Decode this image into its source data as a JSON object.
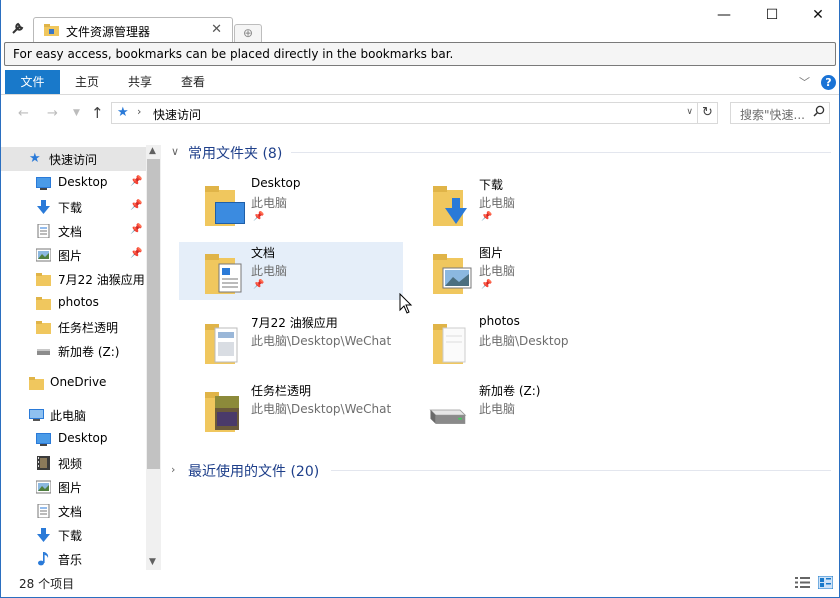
{
  "window": {
    "tab_title": "文件资源管理器",
    "controls": {
      "minimize": "—",
      "maximize": "☐",
      "close": "✕"
    }
  },
  "bookmark_notice": "For easy access, bookmarks can be placed directly in the bookmarks bar.",
  "ribbon": {
    "tabs": [
      "文件",
      "主页",
      "共享",
      "查看"
    ],
    "help": "?"
  },
  "address": {
    "location": "快速访问",
    "search_placeholder": "搜索\"快速...",
    "search_icon": "search-icon"
  },
  "sidebar": {
    "items": [
      {
        "label": "快速访问",
        "icon": "star-icon",
        "pinned": false,
        "selected": true
      },
      {
        "label": "Desktop",
        "icon": "desktop-icon",
        "pinned": true
      },
      {
        "label": "下载",
        "icon": "download-icon",
        "pinned": true
      },
      {
        "label": "文档",
        "icon": "document-icon",
        "pinned": true
      },
      {
        "label": "图片",
        "icon": "picture-icon",
        "pinned": true
      },
      {
        "label": "7月22 油猴应用",
        "icon": "folder-icon",
        "pinned": false
      },
      {
        "label": "photos",
        "icon": "folder-icon",
        "pinned": false
      },
      {
        "label": "任务栏透明",
        "icon": "folder-icon",
        "pinned": false
      },
      {
        "label": "新加卷 (Z:)",
        "icon": "drive-icon",
        "pinned": false
      },
      {
        "label": "OneDrive",
        "icon": "folder-icon",
        "pinned": false
      },
      {
        "label": "此电脑",
        "icon": "computer-icon",
        "pinned": false
      },
      {
        "label": "Desktop",
        "icon": "desktop-icon",
        "pinned": false
      },
      {
        "label": "视频",
        "icon": "video-icon",
        "pinned": false
      },
      {
        "label": "图片",
        "icon": "picture-icon",
        "pinned": false
      },
      {
        "label": "文档",
        "icon": "document-icon",
        "pinned": false
      },
      {
        "label": "下载",
        "icon": "download-icon",
        "pinned": false
      },
      {
        "label": "音乐",
        "icon": "music-icon",
        "pinned": false
      }
    ]
  },
  "main": {
    "frequent_header": "常用文件夹 (8)",
    "recent_header": "最近使用的文件 (20)",
    "tiles": [
      {
        "name": "Desktop",
        "path": "此电脑",
        "pinned": true
      },
      {
        "name": "下载",
        "path": "此电脑",
        "pinned": true
      },
      {
        "name": "文档",
        "path": "此电脑",
        "pinned": true,
        "selected": true
      },
      {
        "name": "图片",
        "path": "此电脑",
        "pinned": true
      },
      {
        "name": "7月22 油猴应用",
        "path": "此电脑\\Desktop\\WeChat",
        "pinned": false
      },
      {
        "name": "photos",
        "path": "此电脑\\Desktop",
        "pinned": false
      },
      {
        "name": "任务栏透明",
        "path": "此电脑\\Desktop\\WeChat",
        "pinned": false
      },
      {
        "name": "新加卷 (Z:)",
        "path": "此电脑",
        "pinned": false
      }
    ]
  },
  "status": {
    "item_count": "28 个项目"
  },
  "colors": {
    "accent": "#1979ca",
    "folder": "#f0c75e",
    "group_header": "#1e3f8a",
    "selection": "#e5eef9"
  }
}
